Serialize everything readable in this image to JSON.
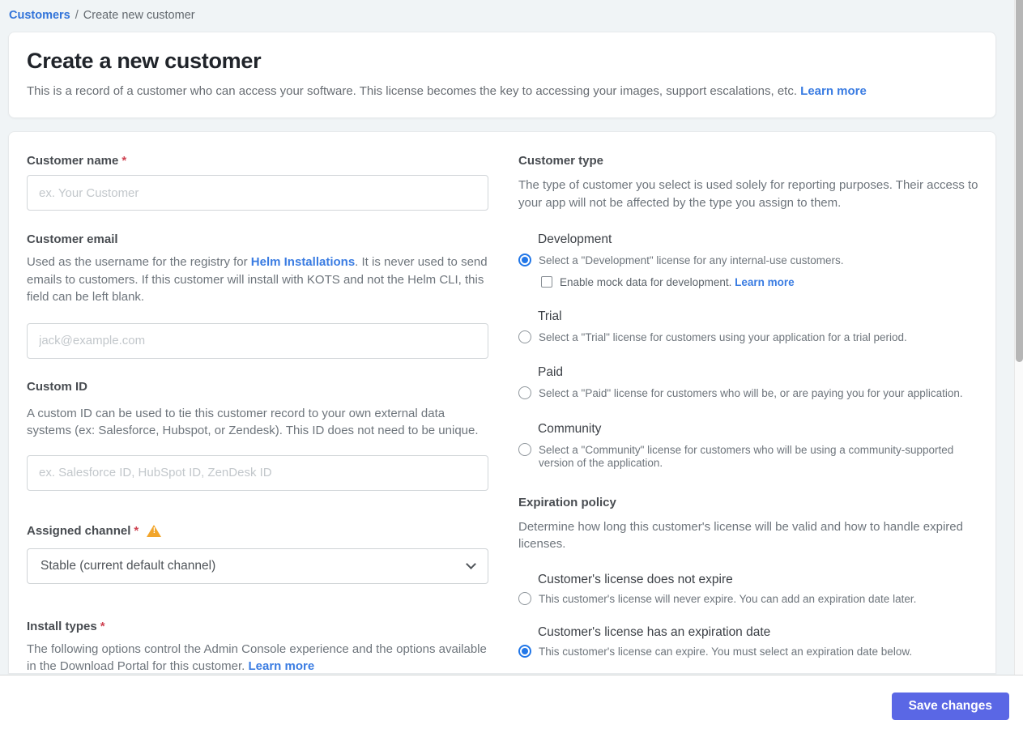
{
  "breadcrumb": {
    "link": "Customers",
    "separator": "/",
    "current": "Create new customer"
  },
  "header": {
    "title": "Create a new customer",
    "description": "This is a record of a customer who can access your software. This license becomes the key to accessing your images, support escalations, etc.",
    "learn_more": "Learn more"
  },
  "ui": {
    "required_mark": "*"
  },
  "form": {
    "customer_name": {
      "label": "Customer name",
      "placeholder": "ex. Your Customer",
      "value": ""
    },
    "customer_email": {
      "label": "Customer email",
      "desc_pre": "Used as the username for the registry for ",
      "desc_link": "Helm Installations",
      "desc_post": ". It is never used to send emails to customers. If this customer will install with KOTS and not the Helm CLI, this field can be left blank.",
      "placeholder": "jack@example.com",
      "value": ""
    },
    "custom_id": {
      "label": "Custom ID",
      "description": "A custom ID can be used to tie this customer record to your own external data systems (ex: Salesforce, Hubspot, or Zendesk). This ID does not need to be unique.",
      "placeholder": "ex. Salesforce ID, HubSpot ID, ZenDesk ID",
      "value": ""
    },
    "assigned_channel": {
      "label": "Assigned channel",
      "selected": "Stable (current default channel)"
    },
    "install_types": {
      "label": "Install types",
      "description": "The following options control the Admin Console experience and the options available in the Download Portal for this customer. ",
      "learn_more": "Learn more"
    }
  },
  "customer_type": {
    "label": "Customer type",
    "description": "The type of customer you select is used solely for reporting purposes. Their access to your app will not be affected by the type you assign to them.",
    "options": [
      {
        "title": "Development",
        "desc": "Select a \"Development\" license for any internal-use customers.",
        "selected": true,
        "checkbox": {
          "label": "Enable mock data for development. ",
          "learn_more": "Learn more",
          "checked": false
        }
      },
      {
        "title": "Trial",
        "desc": "Select a \"Trial\" license for customers using your application for a trial period.",
        "selected": false
      },
      {
        "title": "Paid",
        "desc": "Select a \"Paid\" license for customers who will be, or are paying you for your application.",
        "selected": false
      },
      {
        "title": "Community",
        "desc": "Select a \"Community\" license for customers who will be using a community-supported version of the application.",
        "selected": false
      }
    ]
  },
  "expiration_policy": {
    "label": "Expiration policy",
    "description": "Determine how long this customer's license will be valid and how to handle expired licenses.",
    "options": [
      {
        "title": "Customer's license does not expire",
        "desc": "This customer's license will never expire. You can add an expiration date later.",
        "selected": false
      },
      {
        "title": "Customer's license has an expiration date",
        "desc": "This customer's license can expire. You must select an expiration date below.",
        "selected": true
      }
    ]
  },
  "footer": {
    "save_button": "Save changes"
  },
  "colors": {
    "accent_link": "#3a7ce2",
    "radio_selected": "#2277e8",
    "save_button_bg": "#5a67e5",
    "warning": "#f2a52b",
    "required": "#cf4352",
    "page_background": "#f0f4f6"
  }
}
